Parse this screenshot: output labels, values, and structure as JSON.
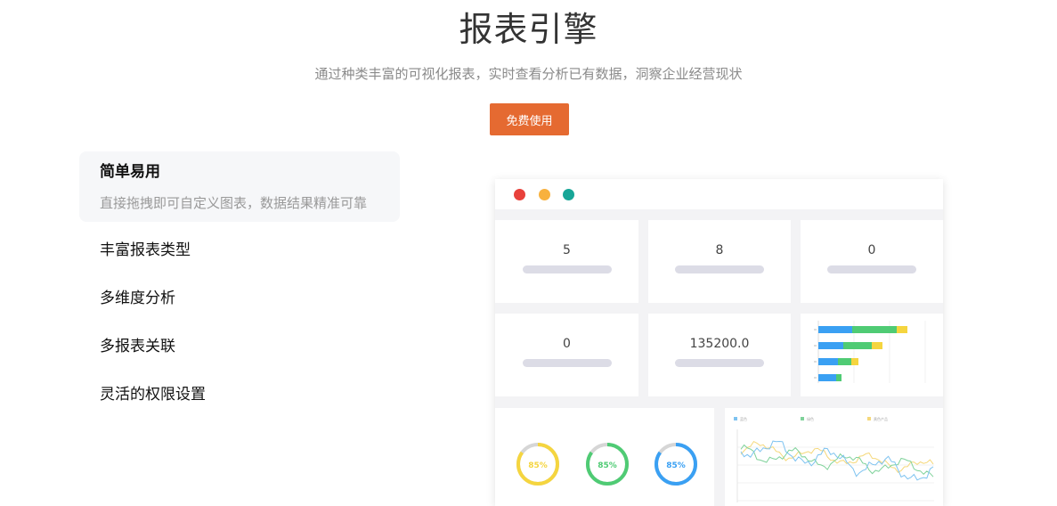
{
  "hero": {
    "title": "报表引擎",
    "subtitle": "通过种类丰富的可视化报表，实时查看分析已有数据，洞察企业经营现状",
    "cta_label": "免费使用"
  },
  "features": {
    "active": {
      "name": "简单易用",
      "desc": "直接拖拽即可自定义图表，数据结果精准可靠"
    },
    "items": [
      "丰富报表类型",
      "多维度分析",
      "多报表关联",
      "灵活的权限设置"
    ]
  },
  "dashboard": {
    "window_dots": [
      "#e8413b",
      "#f8b13e",
      "#17a697"
    ],
    "stats": [
      "5",
      "8",
      "0",
      "0",
      "135200.0"
    ],
    "gauges": [
      {
        "label": "85%",
        "value": 0.85,
        "color": "#f5d53f"
      },
      {
        "label": "85%",
        "value": 0.85,
        "color": "#4fcb74"
      },
      {
        "label": "85%",
        "value": 0.85,
        "color": "#3aa0f3"
      }
    ],
    "stacked_bar": {
      "colors": [
        "#3aa0f3",
        "#4fcb74",
        "#f5d53f"
      ],
      "rows": [
        [
          38,
          50,
          12
        ],
        [
          28,
          32,
          12
        ],
        [
          22,
          15,
          8
        ],
        [
          20,
          6,
          0
        ]
      ]
    },
    "line_legend": [
      {
        "label": "蓝色",
        "color": "#7ec3f0"
      },
      {
        "label": "绿色",
        "color": "#7fd29a"
      },
      {
        "label": "黄色产品",
        "color": "#f5d87a"
      }
    ]
  }
}
